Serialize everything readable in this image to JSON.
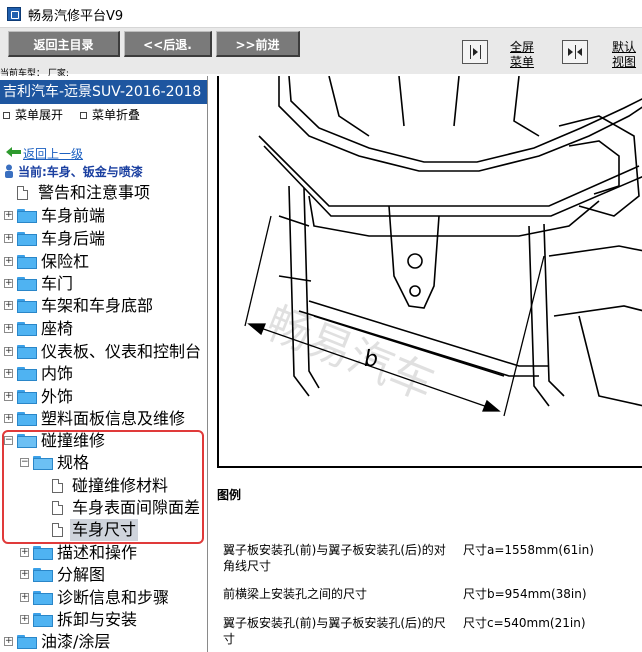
{
  "window": {
    "title": "畅易汽修平台V9"
  },
  "toolbar": {
    "home": "返回主目录",
    "back": "<<后退.",
    "forward": ">>前进",
    "fullscreen_l1": "全屏",
    "fullscreen_l2": "菜单",
    "default_l1": "默认",
    "default_l2": "视图"
  },
  "meta": {
    "line": "当前车型：  厂家:"
  },
  "sidebar": {
    "vehicle": "吉利汽车-远景SUV-2016-2018",
    "expand": "菜单展开",
    "collapse": "菜单折叠",
    "back_up": "返回上一级",
    "current": "当前:车身、钣金与喷漆",
    "items": [
      {
        "label": "警告和注意事项"
      },
      {
        "label": "车身前端"
      },
      {
        "label": "车身后端"
      },
      {
        "label": "保险杠"
      },
      {
        "label": "车门"
      },
      {
        "label": "车架和车身底部"
      },
      {
        "label": "座椅"
      },
      {
        "label": "仪表板、仪表和控制台"
      },
      {
        "label": "内饰"
      },
      {
        "label": "外饰"
      },
      {
        "label": "塑料面板信息及维修"
      },
      {
        "label": "碰撞维修"
      },
      {
        "label": "规格"
      },
      {
        "label": "碰撞维修材料"
      },
      {
        "label": "车身表面间隙面差"
      },
      {
        "label": "车身尺寸"
      },
      {
        "label": "描述和操作"
      },
      {
        "label": "分解图"
      },
      {
        "label": "诊断信息和步骤"
      },
      {
        "label": "拆卸与安装"
      },
      {
        "label": "油漆/涂层"
      }
    ]
  },
  "content": {
    "dimension_label": "b",
    "watermark": "畅易汽车",
    "legend_title": "图例",
    "legend": [
      {
        "desc": "翼子板安装孔(前)与翼子板安装孔(后)的对角线尺寸",
        "value": "尺寸a=1558mm(61in)"
      },
      {
        "desc": "前横梁上安装孔之间的尺寸",
        "value": "尺寸b=954mm(38in)"
      },
      {
        "desc": "翼子板安装孔(前)与翼子板安装孔(后)的尺寸",
        "value": "尺寸c=540mm(21in)"
      }
    ]
  },
  "colors": {
    "vehicle_bar": "#1e56a0",
    "highlight": "#e03a3a",
    "selected": "#cfd4dc"
  }
}
